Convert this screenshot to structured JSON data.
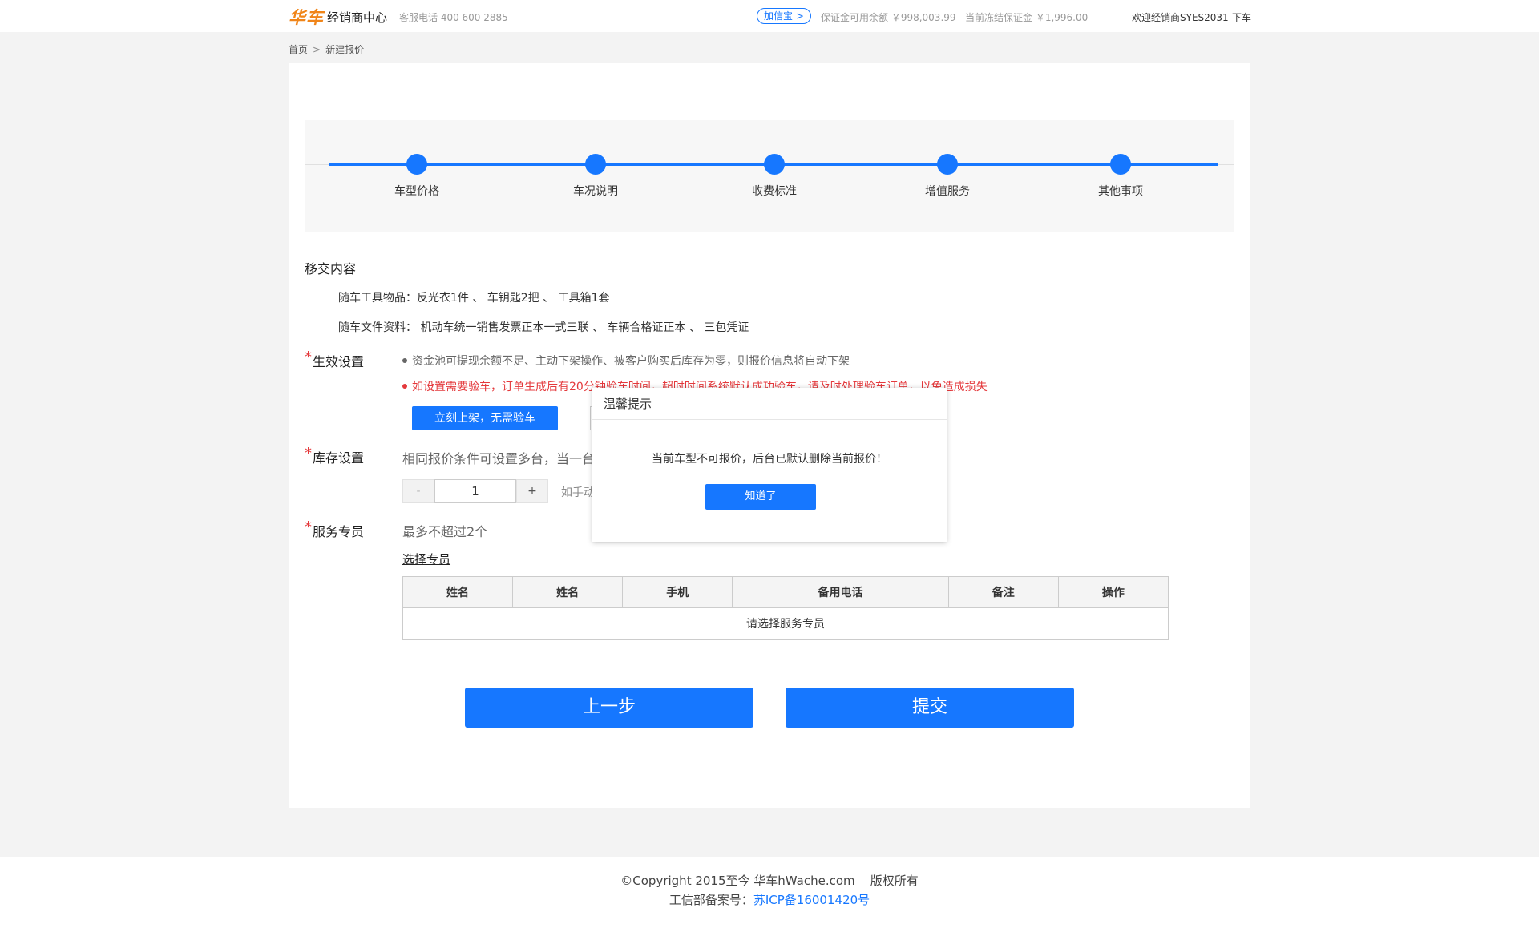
{
  "header": {
    "logo": "华车",
    "brand": "经销商中心",
    "hotline": "客服电话 400 600 2885",
    "jiaxinbao": "加信宝 >",
    "balance_available": "保证金可用余额 ￥998,003.99",
    "balance_frozen": "当前冻结保证金 ￥1,996.00",
    "welcome": "欢迎经销商SYES2031",
    "logout": "下车"
  },
  "breadcrumb": {
    "home": "首页",
    "separator": ">",
    "current": "新建报价"
  },
  "steps": [
    "车型价格",
    "车况说明",
    "收费标准",
    "增值服务",
    "其他事项"
  ],
  "handover": {
    "title": "移交内容",
    "tools": "随车工具物品：反光衣1件 、 车钥匙2把 、 工具箱1套",
    "docs": "随车文件资料： 机动车统一销售发票正本一式三联 、 车辆合格证正本 、 三包凭证"
  },
  "effective": {
    "label": "生效设置",
    "note1": "资金池可提现余额不足、主动下架操作、被客户购买后库存为零，则报价信息将自动下架",
    "note2": "如设置需要验车，订单生成后有20分钟验车时间，超时时间系统默认成功验车，请及时处理验车订单，以免造成损失",
    "button_now": "立刻上架，无需验车"
  },
  "stock": {
    "label": "库存设置",
    "hint": "相同报价条件可设置多台，当一台",
    "minus": "-",
    "value": "1",
    "plus": "+",
    "manual_hint": "如手动"
  },
  "service": {
    "label": "服务专员",
    "hint": "最多不超过2个",
    "select_link": "选择专员",
    "columns": [
      "姓名",
      "姓名",
      "手机",
      "备用电话",
      "备注",
      "操作"
    ],
    "empty": "请选择服务专员"
  },
  "actions": {
    "prev": "上一步",
    "submit": "提交"
  },
  "footer": {
    "copyright": "©Copyright 2015至今 华车hWache.com    版权所有",
    "icp_label": "工信部备案号：",
    "icp": "苏ICP备16001420号"
  },
  "modal": {
    "title": "温馨提示",
    "message": "当前车型不可报价，后台已默认删除当前报价！",
    "ok": "知道了"
  },
  "colors": {
    "accent": "#1677ff",
    "logo": "#f08519",
    "warning": "#e4393c"
  }
}
